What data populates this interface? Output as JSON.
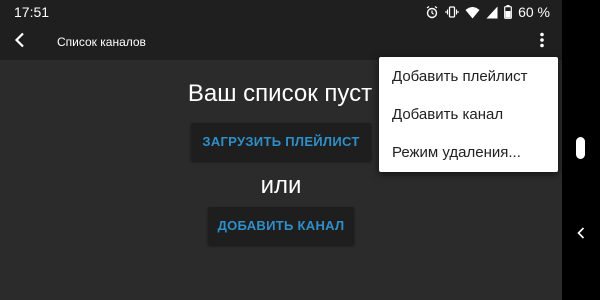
{
  "status_bar": {
    "time": "17:51",
    "battery_percent": "60 %",
    "icons": [
      "alarm-icon",
      "vibrate-icon",
      "wifi-icon",
      "signal-icon",
      "battery-icon"
    ]
  },
  "app_bar": {
    "title": "Список каналов",
    "back_icon": "chevron-left-icon",
    "overflow_icon": "more-vert-icon"
  },
  "empty_state": {
    "title": "Ваш список пуст",
    "load_playlist_label": "ЗАГРУЗИТЬ ПЛЕЙЛИСТ",
    "or_label": "или",
    "add_channel_label": "ДОБАВИТЬ КАНАЛ"
  },
  "overflow_menu": {
    "items": [
      {
        "label": "Добавить плейлист"
      },
      {
        "label": "Добавить канал"
      },
      {
        "label": "Режим удаления..."
      }
    ]
  },
  "nav_bar": {
    "home_icon": "home-pill-icon",
    "back_icon": "nav-back-icon"
  },
  "colors": {
    "background": "#2b2b2b",
    "bar": "#1f1f1f",
    "button_text": "#2f8fc9",
    "menu_bg": "#ffffff"
  }
}
